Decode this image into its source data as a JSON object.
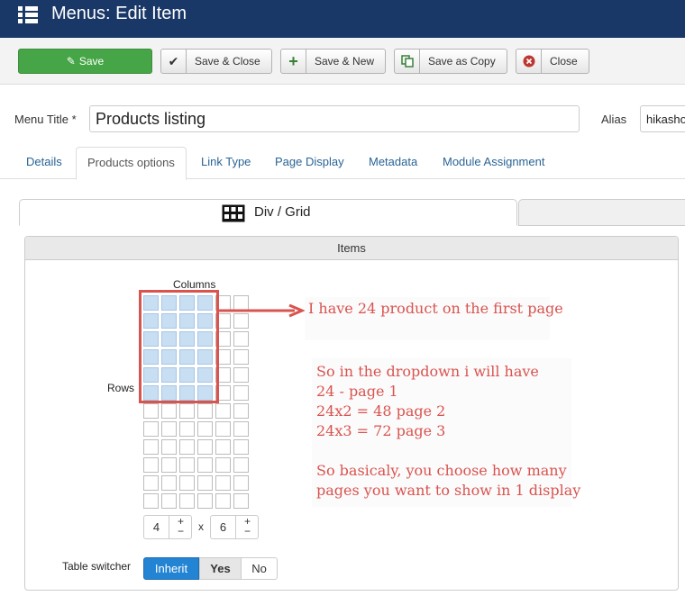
{
  "header": {
    "title": "Menus: Edit Item",
    "color": "#1a3867"
  },
  "toolbar": {
    "save": "Save",
    "save_close": "Save & Close",
    "save_new": "Save & New",
    "save_copy": "Save as Copy",
    "close": "Close"
  },
  "form": {
    "menu_title_label": "Menu Title *",
    "menu_title_value": "Products listing",
    "alias_label": "Alias",
    "alias_value": "hikasho"
  },
  "tabs": [
    "Details",
    "Products options",
    "Link Type",
    "Page Display",
    "Metadata",
    "Module Assignment"
  ],
  "subtab": {
    "label": "Div / Grid"
  },
  "items_panel": {
    "header": "Items",
    "columns_label": "Columns",
    "rows_label": "Rows",
    "grid": {
      "columns_total": 6,
      "rows_total": 12,
      "selected_columns": 4,
      "selected_rows": 6
    },
    "rows_value": "4",
    "times": "x",
    "columns_value": "6",
    "plus": "+",
    "minus": "−",
    "table_switcher_label": "Table switcher",
    "switch_options": [
      "Inherit",
      "Yes",
      "No"
    ],
    "switch_active": "Inherit"
  },
  "annotation": {
    "line1": "I have 24 product on the first page",
    "lines": [
      "So in the dropdown i will have",
      "24 - page 1",
      "24x2 = 48 page 2",
      "24x3 = 72 page 3",
      "",
      "So basicaly, you choose how many",
      "pages you want to show in 1 display"
    ],
    "color": "#d9534f"
  }
}
